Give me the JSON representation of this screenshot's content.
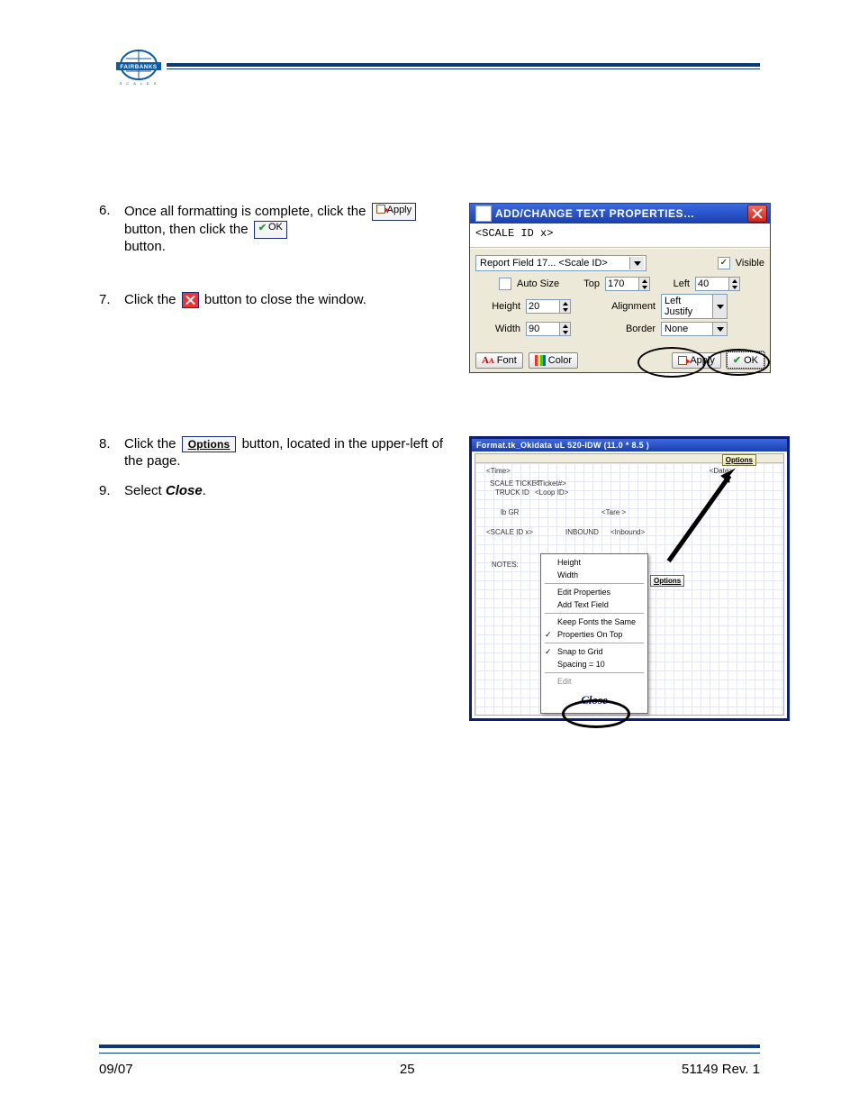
{
  "steps": {
    "s6": {
      "num": "6.",
      "t1": "Once all formatting is complete, click the ",
      "t2": " button, then click the ",
      "t3": " button."
    },
    "s7": {
      "num": "7.",
      "t1": "Click the ",
      "t2": " button to close the window."
    },
    "s8": {
      "num": "8.",
      "t1": "Click the ",
      "t2": " button, located in the upper-left of the page."
    },
    "s9": {
      "num": "9.",
      "t1": "Select ",
      "t2": "Close",
      "t3": "."
    }
  },
  "inline_buttons": {
    "apply": "Apply",
    "ok": "OK",
    "options": "Options"
  },
  "dialog": {
    "title": "ADD/CHANGE TEXT PROPERTIES…",
    "sample_text": "<SCALE ID  x>",
    "combo": "Report Field 17... <Scale ID>",
    "visible_label": "Visible",
    "auto_size_label": "Auto Size",
    "top_label": "Top",
    "top_val": "170",
    "left_label": "Left",
    "left_val": "40",
    "height_label": "Height",
    "height_val": "20",
    "alignment_label": "Alignment",
    "alignment_val": "Left Justify",
    "width_label": "Width",
    "width_val": "90",
    "border_label": "Border",
    "border_val": "None",
    "btn_font": "Font",
    "btn_color": "Color",
    "btn_apply": "Apply",
    "btn_ok": "OK"
  },
  "designer": {
    "title": "Format.tk_Okidata uL 520-IDW (11.0 * 8.5 )",
    "fields": {
      "time": "<Time>",
      "scale_ticket": "SCALE TICKET",
      "ticket": "<Ticket#>",
      "truck_id": "TRUCK ID",
      "loop_id": "<Loop ID>",
      "lb_gr": "lb GR",
      "tare": "<Tare >",
      "scale_id_x": "<SCALE ID  x>",
      "inbound_lbl": "INBOUND",
      "inbound": "<Inbound>",
      "notes": "NOTES:",
      "date": "<Date>"
    },
    "options_btn": "Options",
    "opts_mini": "Options",
    "menu": {
      "height": "Height",
      "width": "Width",
      "edit_props": "Edit Properties",
      "add_text": "Add Text Field",
      "keep_fonts": "Keep Fonts the Same",
      "props_on_top": "Properties On Top",
      "snap": "Snap to Grid",
      "spacing": "Spacing = 10",
      "edit": "Edit",
      "close": "Close"
    }
  },
  "footer": {
    "left": "09/07",
    "center": "25",
    "right": "51149   Rev. 1"
  }
}
